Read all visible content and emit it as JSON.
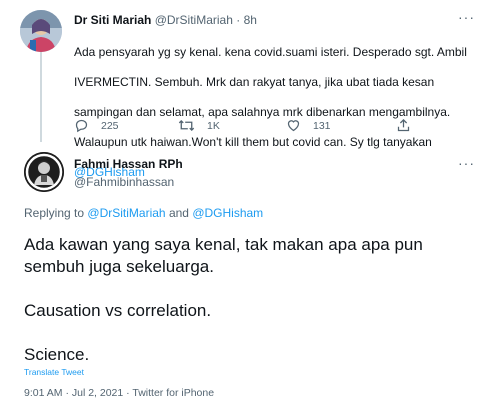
{
  "first_tweet": {
    "author_name": "Dr Siti Mariah",
    "author_handle": "@DrSitiMariah",
    "time": "8h",
    "body_lines": [
      "Ada pensyarah yg sy kenal. kena covid.suami isteri. Desperado sgt. Ambil",
      "IVERMECTIN. Sembuh. Mrk dan rakyat tanya, jika ubat tiada kesan",
      "sampingan dan selamat, apa salahnya mrk dibenarkan mengambilnya.",
      "Walaupun utk haiwan.Won't  kill them but covid can. Sy tlg tanyakan"
    ],
    "mention": "@DGHisham",
    "replies": "225",
    "retweets": "1K",
    "likes": "131"
  },
  "second_tweet": {
    "author_name": "Fahmi Hassan RPh",
    "author_handle": "@Fahmibinhassan",
    "replying_prefix": "Replying to",
    "reply_mention_1": "@DrSitiMariah",
    "reply_and": "and",
    "reply_mention_2": "@DGHisham",
    "text_paragraphs": [
      "Ada kawan yang saya kenal, tak makan apa apa pun sembuh juga sekeluarga.",
      "Causation vs correlation.",
      "Science."
    ],
    "translate_label": "Translate Tweet",
    "timestamp": "9:01 AM · Jul 2, 2021 · Twitter for iPhone"
  },
  "more_glyph": "···",
  "colors": {
    "accent": "#1d9bf0",
    "secondary_text": "#536471",
    "primary_text": "#0f1419",
    "thread_line": "#cfd9de"
  },
  "icons": [
    "reply-icon",
    "retweet-icon",
    "like-icon",
    "share-icon",
    "more-icon"
  ]
}
